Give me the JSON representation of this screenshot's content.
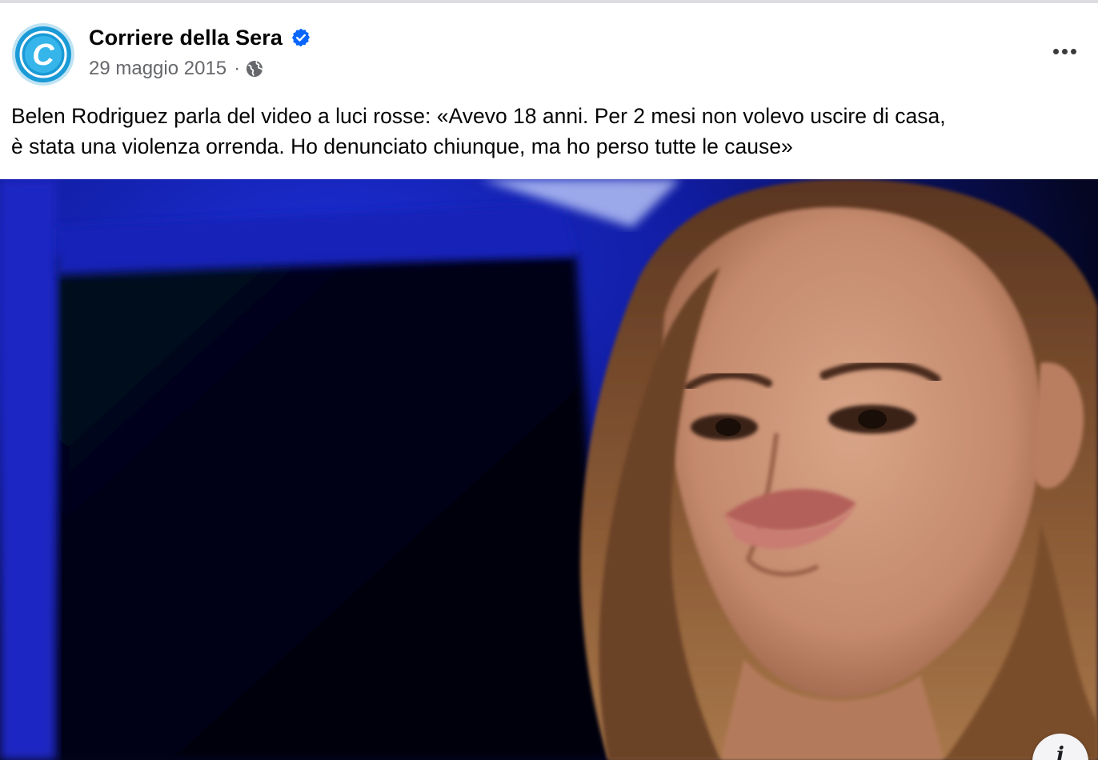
{
  "post": {
    "author": {
      "name": "Corriere della Sera",
      "verified": true,
      "avatar_letter": "C",
      "avatar_icon": "corriere-logo"
    },
    "date": "29 maggio 2015",
    "separator": "·",
    "audience_icon": "globe-icon",
    "more_icon": "more-dots-icon",
    "caption_lines": [
      "Belen Rodriguez parla del video a luci rosse: «Avevo 18 anni. Per 2 mesi non volevo uscire di casa,",
      "è stata una violenza orrenda. Ho denunciato chiunque, ma ho perso tutte le cause»"
    ],
    "image": {
      "description_icon": "photo",
      "info_icon": "info-icon",
      "info_glyph": "i"
    }
  },
  "colors": {
    "name_text": "#050505",
    "meta_text": "#65676b",
    "verified_badge": "#0866ff",
    "avatar_blue": "#1a9ad6",
    "background": "#ffffff"
  }
}
